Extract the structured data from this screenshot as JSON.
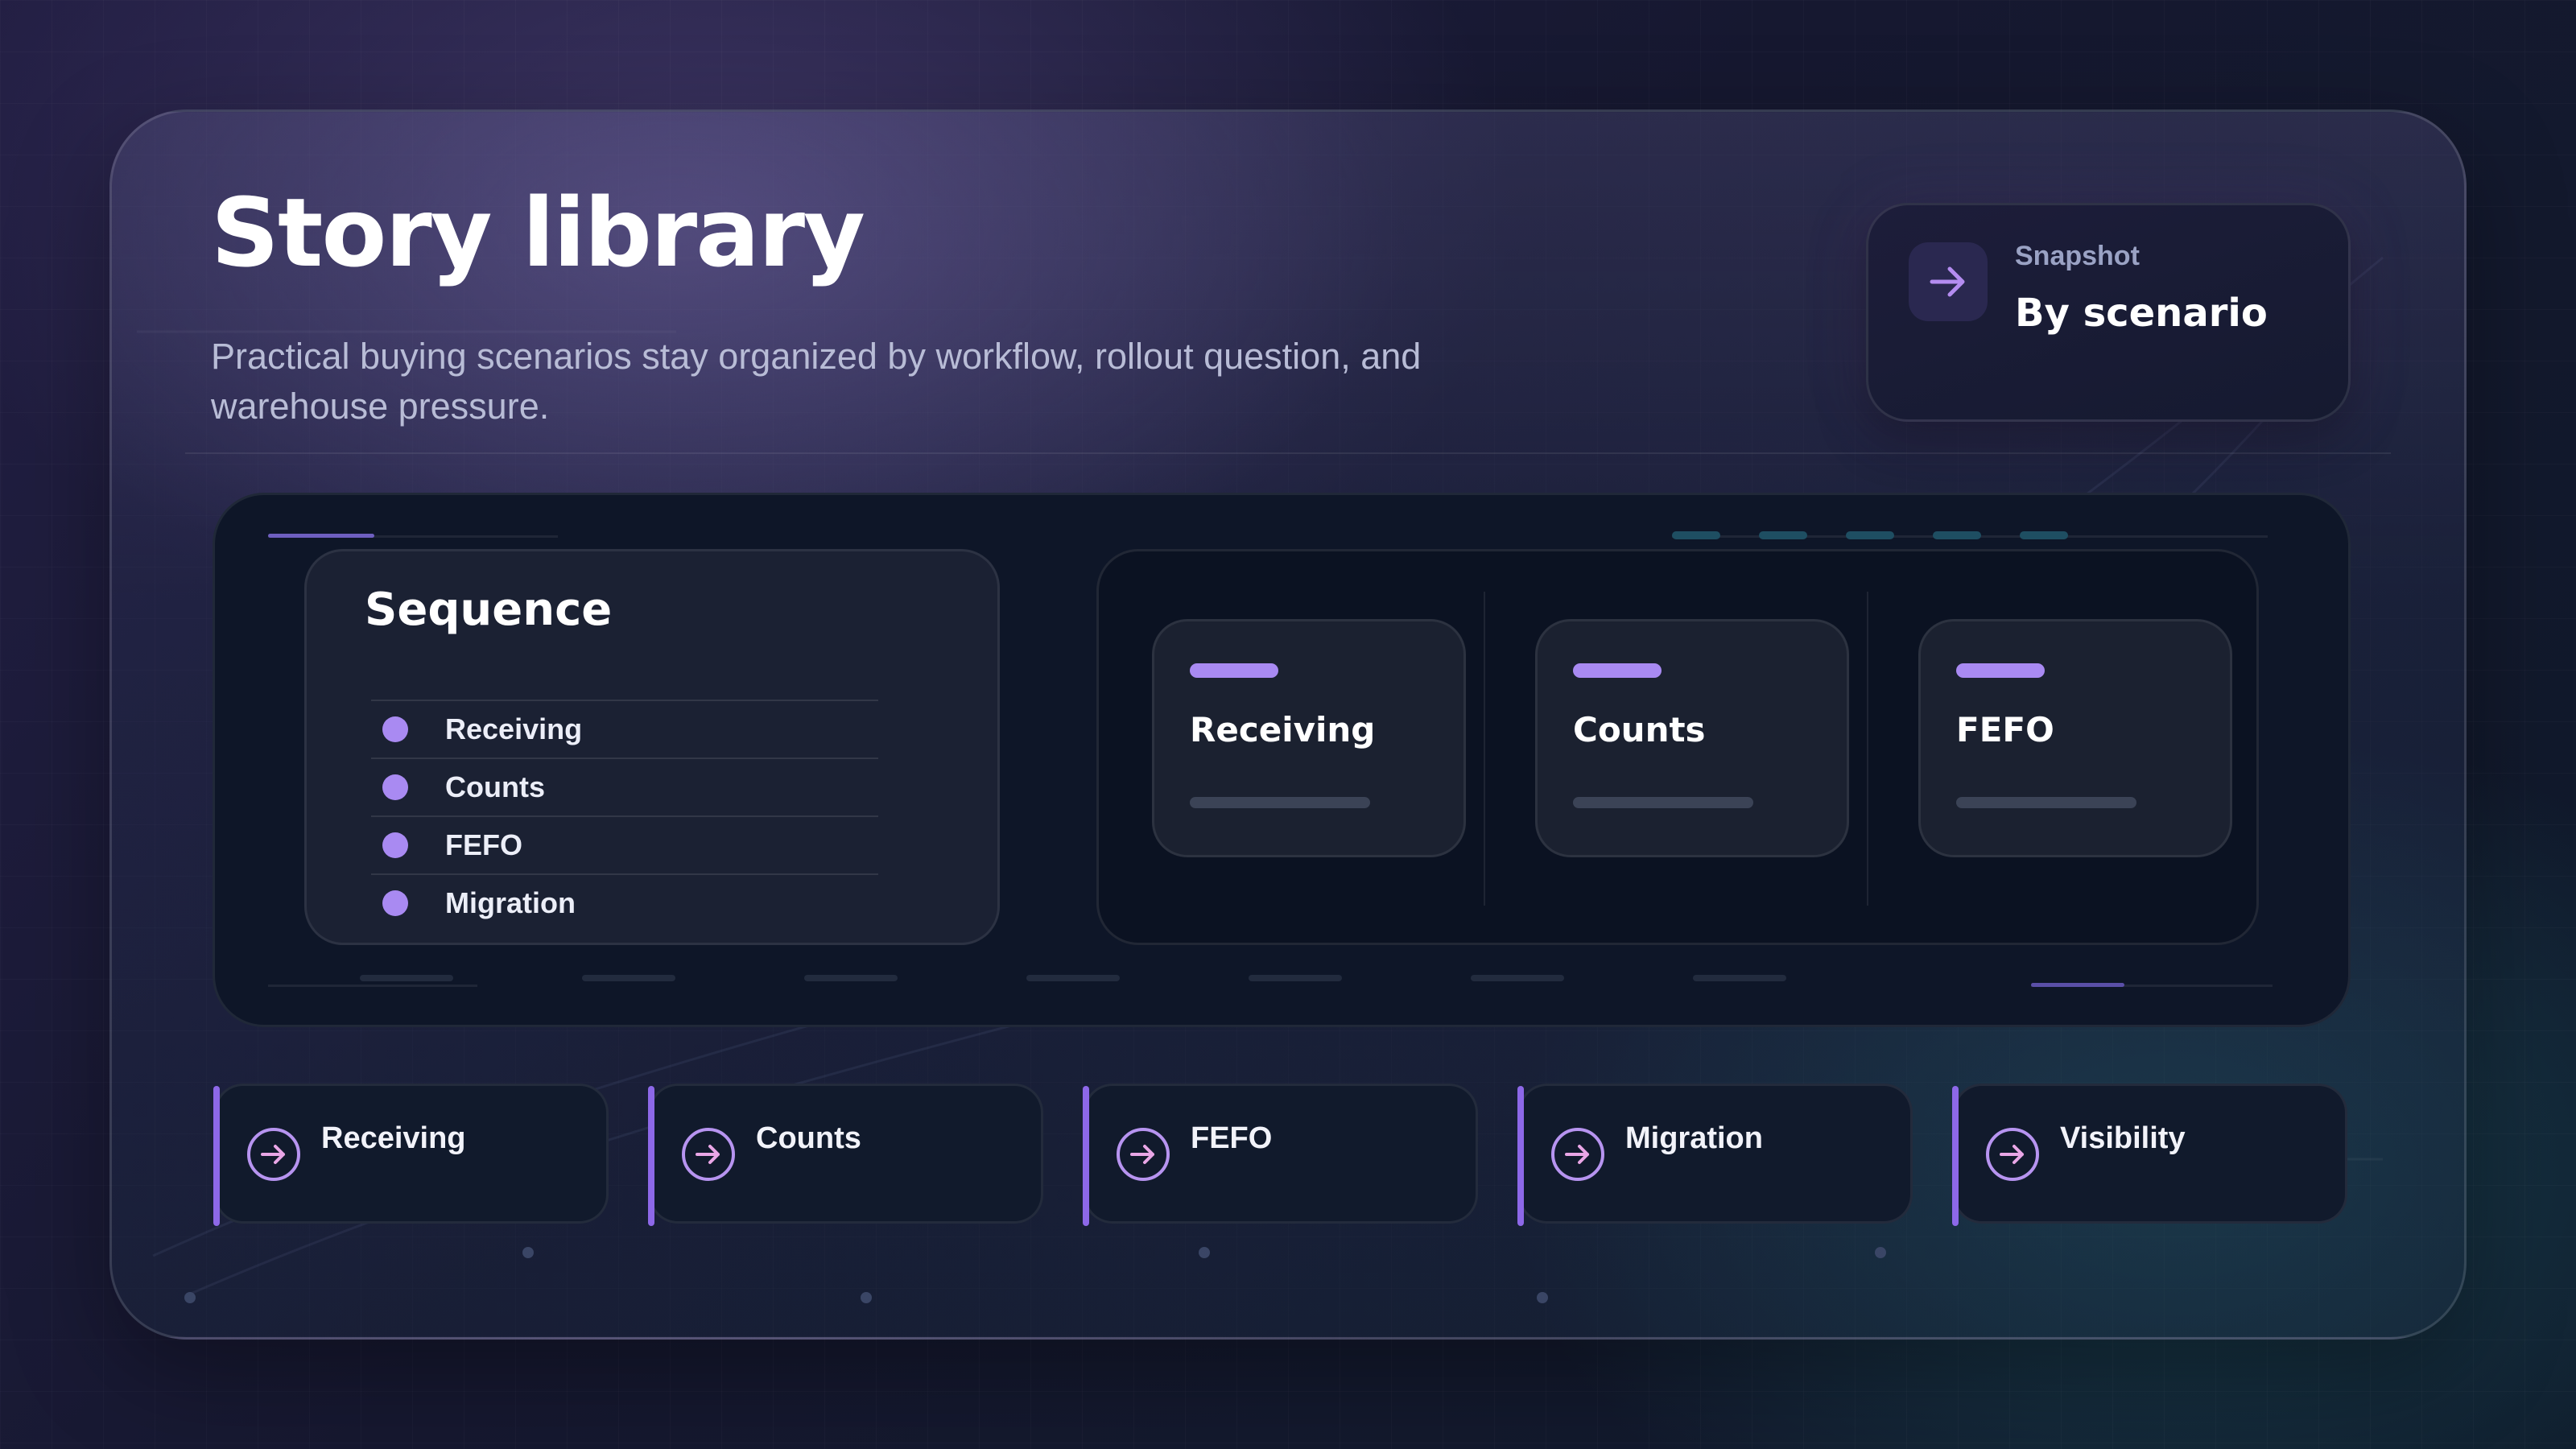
{
  "header": {
    "title": "Story library",
    "subtitle": "Practical buying scenarios stay organized by workflow, rollout question, and warehouse pressure."
  },
  "snapshot": {
    "kicker": "Snapshot",
    "value": "By scenario",
    "icon": "arrow-right-icon"
  },
  "sequence": {
    "title": "Sequence",
    "items": [
      {
        "label": "Receiving"
      },
      {
        "label": "Counts"
      },
      {
        "label": "FEFO"
      },
      {
        "label": "Migration"
      }
    ]
  },
  "feature_cards": [
    {
      "label": "Receiving"
    },
    {
      "label": "Counts"
    },
    {
      "label": "FEFO"
    }
  ],
  "chips": [
    {
      "label": "Receiving",
      "icon": "arrow-right-circle-icon"
    },
    {
      "label": "Counts",
      "icon": "arrow-right-circle-icon"
    },
    {
      "label": "FEFO",
      "icon": "arrow-right-circle-icon"
    },
    {
      "label": "Migration",
      "icon": "arrow-right-circle-icon"
    },
    {
      "label": "Visibility",
      "icon": "arrow-right-circle-icon"
    }
  ],
  "colors": {
    "accent": "#a98af2",
    "accent_deep": "#8d68e8",
    "icon_pink": "#e9a6e6",
    "stage_bg": "#0e1628",
    "card_bg": "#1b2133"
  }
}
